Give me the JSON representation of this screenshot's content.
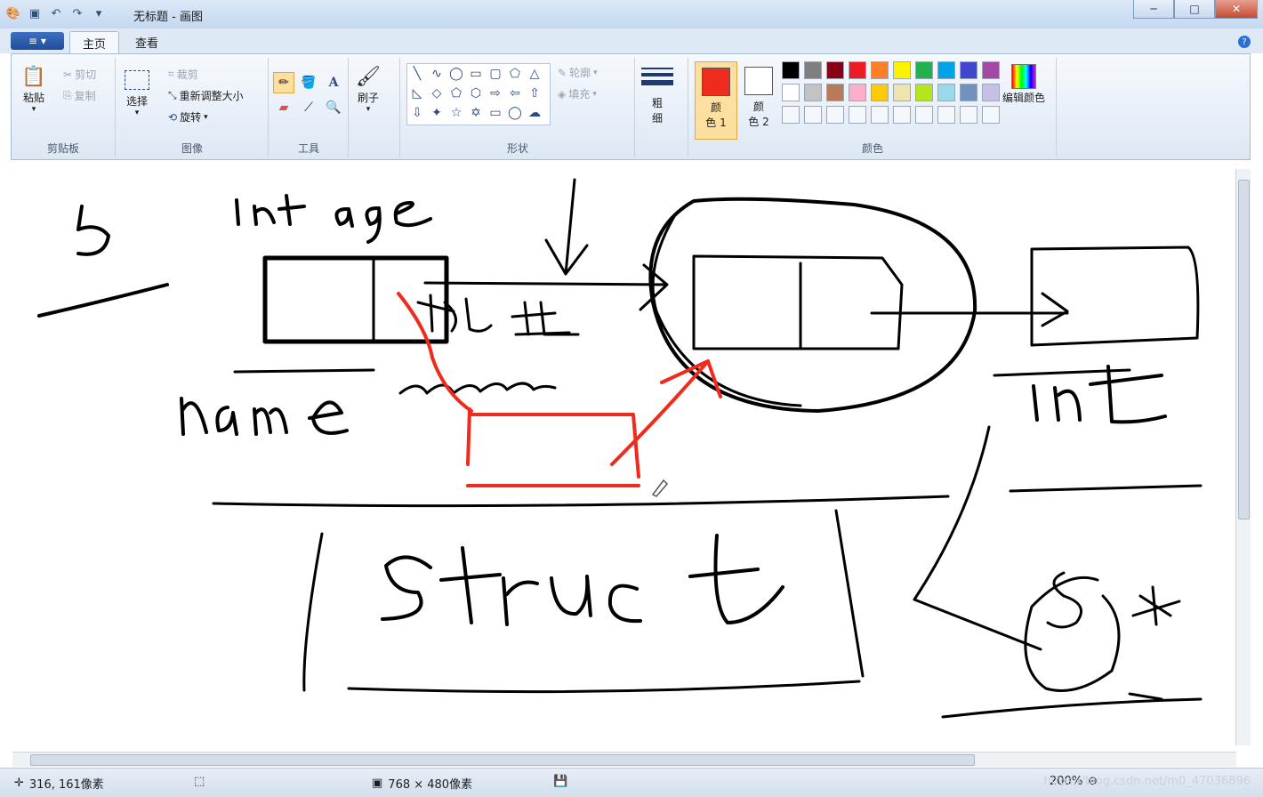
{
  "window": {
    "title": "无标题 - 画图"
  },
  "ribbon_tabs": {
    "file_icon": "≡",
    "home": "主页",
    "view": "查看"
  },
  "clipboard": {
    "paste": "粘贴",
    "cut": "剪切",
    "copy": "复制",
    "label": "剪贴板"
  },
  "image": {
    "select": "选择",
    "crop": "裁剪",
    "resize": "重新调整大小",
    "rotate": "旋转",
    "label": "图像"
  },
  "tools": {
    "label": "工具"
  },
  "brushes": {
    "label": "刷子"
  },
  "shapes": {
    "outline": "轮廓",
    "fill": "填充",
    "label": "形状"
  },
  "size": {
    "label_top": "粗",
    "label_bottom": "细"
  },
  "colors": {
    "color1_top": "颜",
    "color1_bottom": "色 1",
    "color2_top": "颜",
    "color2_bottom": "色 2",
    "edit": "编辑颜色",
    "label": "颜色",
    "color1": "#ee2b1c",
    "color2": "#ffffff",
    "palette_row1": [
      "#000000",
      "#7f7f7f",
      "#880015",
      "#ed1c24",
      "#ff7f27",
      "#fff200",
      "#22b14c",
      "#00a2e8",
      "#3f48cc",
      "#a349a4"
    ],
    "palette_row2": [
      "#ffffff",
      "#c3c3c3",
      "#b97a57",
      "#ffaec9",
      "#ffc90e",
      "#efe4b0",
      "#b5e61d",
      "#99d9ea",
      "#7092be",
      "#c8bfe7"
    ]
  },
  "status": {
    "cursor_pos": "316, 161像素",
    "canvas_size": "768 × 480像素",
    "zoom": "200%",
    "watermark": "https://blog.csdn.net/m0_47036896"
  }
}
